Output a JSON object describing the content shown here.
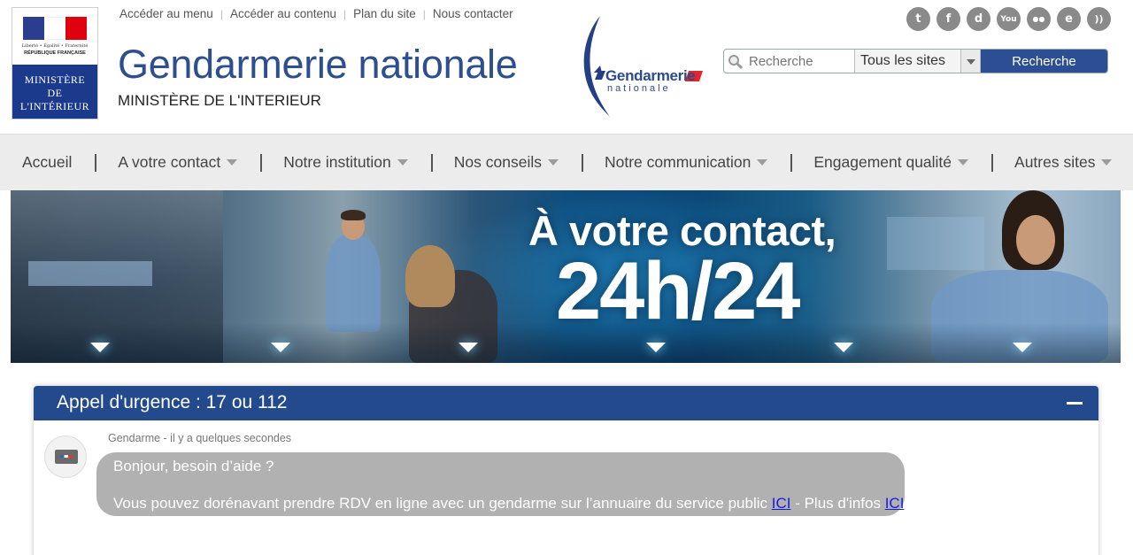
{
  "header": {
    "emblem": {
      "motto": "Liberté • Égalité • Fraternité",
      "republic": "RÉPUBLIQUE FRANÇAISE",
      "ministry_lines": [
        "MINISTÈRE",
        "DE",
        "L'INTÉRIEUR"
      ]
    },
    "top_links": [
      "Accéder au menu",
      "Accéder au contenu",
      "Plan du site",
      "Nous contacter"
    ],
    "title": "Gendarmerie nationale",
    "subtitle": "MINISTÈRE DE L'INTERIEUR",
    "logo": {
      "line1": "Gendarmerie",
      "line2": "nationale"
    },
    "social_icons": [
      "twitter-icon",
      "facebook-icon",
      "dailymotion-icon",
      "youtube-icon",
      "flickr-icon",
      "scoopit-icon",
      "rss-icon"
    ],
    "social_glyphs": [
      "t",
      "f",
      "d",
      "You",
      "●●",
      "e",
      "))"
    ],
    "search": {
      "placeholder": "Recherche",
      "scope_selected": "Tous les sites",
      "button_label": "Recherche"
    }
  },
  "nav": {
    "items": [
      {
        "label": "Accueil",
        "has_dropdown": false
      },
      {
        "label": "A votre contact",
        "has_dropdown": true
      },
      {
        "label": "Notre institution",
        "has_dropdown": true
      },
      {
        "label": "Nos conseils",
        "has_dropdown": true
      },
      {
        "label": "Notre communication",
        "has_dropdown": true
      },
      {
        "label": "Engagement qualité",
        "has_dropdown": true
      },
      {
        "label": "Autres sites",
        "has_dropdown": true
      }
    ]
  },
  "banner": {
    "line1": "À votre contact,",
    "line2": "24h/24"
  },
  "chat": {
    "title": "Appel d'urgence : 17 ou 112",
    "sender_meta": "Gendarme - il y a quelques secondes",
    "message_line1": "Bonjour, besoin d’aide ?",
    "message_line2_prefix": "Vous pouvez dorénavant prendre RDV en ligne avec un gendarme sur l’annuaire du service public ",
    "link1": "ICI",
    "message_line2_middle": " - Plus d'infos ",
    "link2": "ICI"
  },
  "colors": {
    "brand_blue": "#2e4f8f",
    "chat_header": "#244a8e",
    "bubble_gray": "#b1b1b1",
    "nav_bg": "#ececec"
  }
}
